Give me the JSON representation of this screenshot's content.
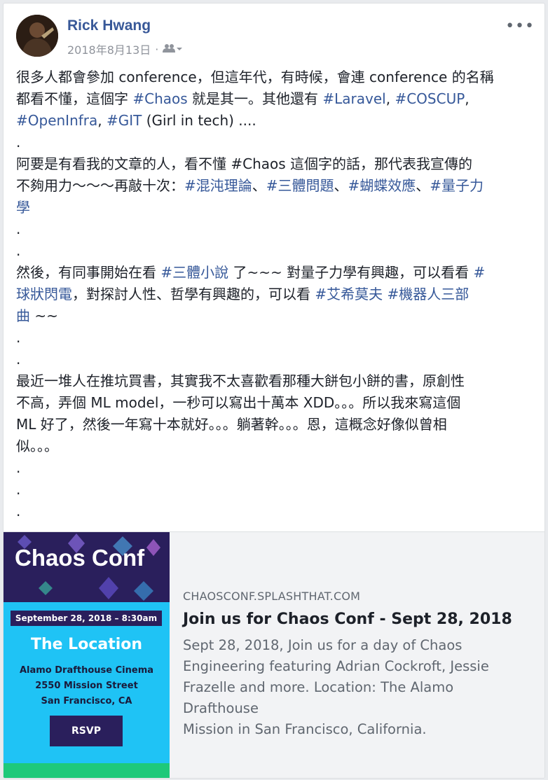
{
  "post": {
    "author": "Rick Hwang",
    "date": "2018年8月13日",
    "separator": "·",
    "body_lines": [
      [
        {
          "t": "很多人都會參加 conference，但這年代，有時候，會連 conference 的名稱"
        }
      ],
      [
        {
          "t": "都看不懂，這個字 "
        },
        {
          "t": "#Chaos",
          "tag": true
        },
        {
          "t": " 就是其一。其他還有 "
        },
        {
          "t": "#Laravel",
          "tag": true
        },
        {
          "t": ", "
        },
        {
          "t": "#COSCUP",
          "tag": true
        },
        {
          "t": ","
        }
      ],
      [
        {
          "t": "#OpenInfra",
          "tag": true
        },
        {
          "t": ", "
        },
        {
          "t": "#GIT",
          "tag": true
        },
        {
          "t": " (Girl in tech) ...."
        }
      ],
      [
        {
          "t": "."
        }
      ],
      [
        {
          "t": "阿要是有看我的文章的人，看不懂 #Chaos 這個字的話，那代表我宣傳的"
        }
      ],
      [
        {
          "t": "不夠用力～～～再敲十次："
        },
        {
          "t": "#混沌理論",
          "tag": true
        },
        {
          "t": "、"
        },
        {
          "t": "#三體問題",
          "tag": true
        },
        {
          "t": "、"
        },
        {
          "t": "#蝴蝶效應",
          "tag": true
        },
        {
          "t": "、"
        },
        {
          "t": "#量子力",
          "tag": true
        }
      ],
      [
        {
          "t": "學",
          "tag": true
        }
      ],
      [
        {
          "t": "."
        }
      ],
      [
        {
          "t": "."
        }
      ],
      [
        {
          "t": "然後，有同事開始在看 "
        },
        {
          "t": "#三體小說",
          "tag": true
        },
        {
          "t": " 了~~~ 對量子力學有興趣，可以看看 "
        },
        {
          "t": "#",
          "tag": true
        }
      ],
      [
        {
          "t": "球狀閃電",
          "tag": true
        },
        {
          "t": "，對探討人性、哲學有興趣的，可以看 "
        },
        {
          "t": "#艾希莫夫",
          "tag": true
        },
        {
          "t": " "
        },
        {
          "t": "#機器人三部",
          "tag": true
        }
      ],
      [
        {
          "t": "曲",
          "tag": true
        },
        {
          "t": " ~~"
        }
      ],
      [
        {
          "t": "."
        }
      ],
      [
        {
          "t": "."
        }
      ],
      [
        {
          "t": "最近一堆人在推坑買書，其實我不太喜歡看那種大餅包小餅的書，原創性"
        }
      ],
      [
        {
          "t": "不高，弄個 ML model，一秒可以寫出十萬本 XDD。。。所以我來寫這個"
        }
      ],
      [
        {
          "t": "ML 好了，然後一年寫十本就好。。。躺著幹。。。恩，這概念好像似曾相"
        }
      ],
      [
        {
          "t": "似。。。"
        }
      ],
      [
        {
          "t": "."
        }
      ],
      [
        {
          "t": "."
        }
      ],
      [
        {
          "t": "."
        }
      ]
    ]
  },
  "link": {
    "image": {
      "logo": "Chaos Conf",
      "date_band": "September 28, 2018 – 8:30am",
      "location_title": "The Location",
      "location_lines": [
        "Alamo Drafthouse Cinema",
        "2550 Mission Street",
        "San Francisco, CA"
      ],
      "rsvp": "RSVP"
    },
    "domain": "CHAOSCONF.SPLASHTHAT.COM",
    "title": "Join us for Chaos Conf - Sept 28, 2018",
    "description_lines": [
      "Sept 28, 2018, Join us for a day of Chaos",
      "Engineering featuring Adrian Cockroft, Jessie",
      "Frazelle and more. Location: The Alamo Drafthouse",
      "Mission in San Francisco, California."
    ]
  },
  "icons": {
    "audience": "friends-audience-icon",
    "more": "more-options-icon"
  },
  "colors": {
    "link": "#365899",
    "name": "#385898",
    "meta": "#90949c",
    "thumb_blue": "#1fc3f5",
    "thumb_navy": "#2a1f5c",
    "thumb_green": "#1ec97a"
  }
}
